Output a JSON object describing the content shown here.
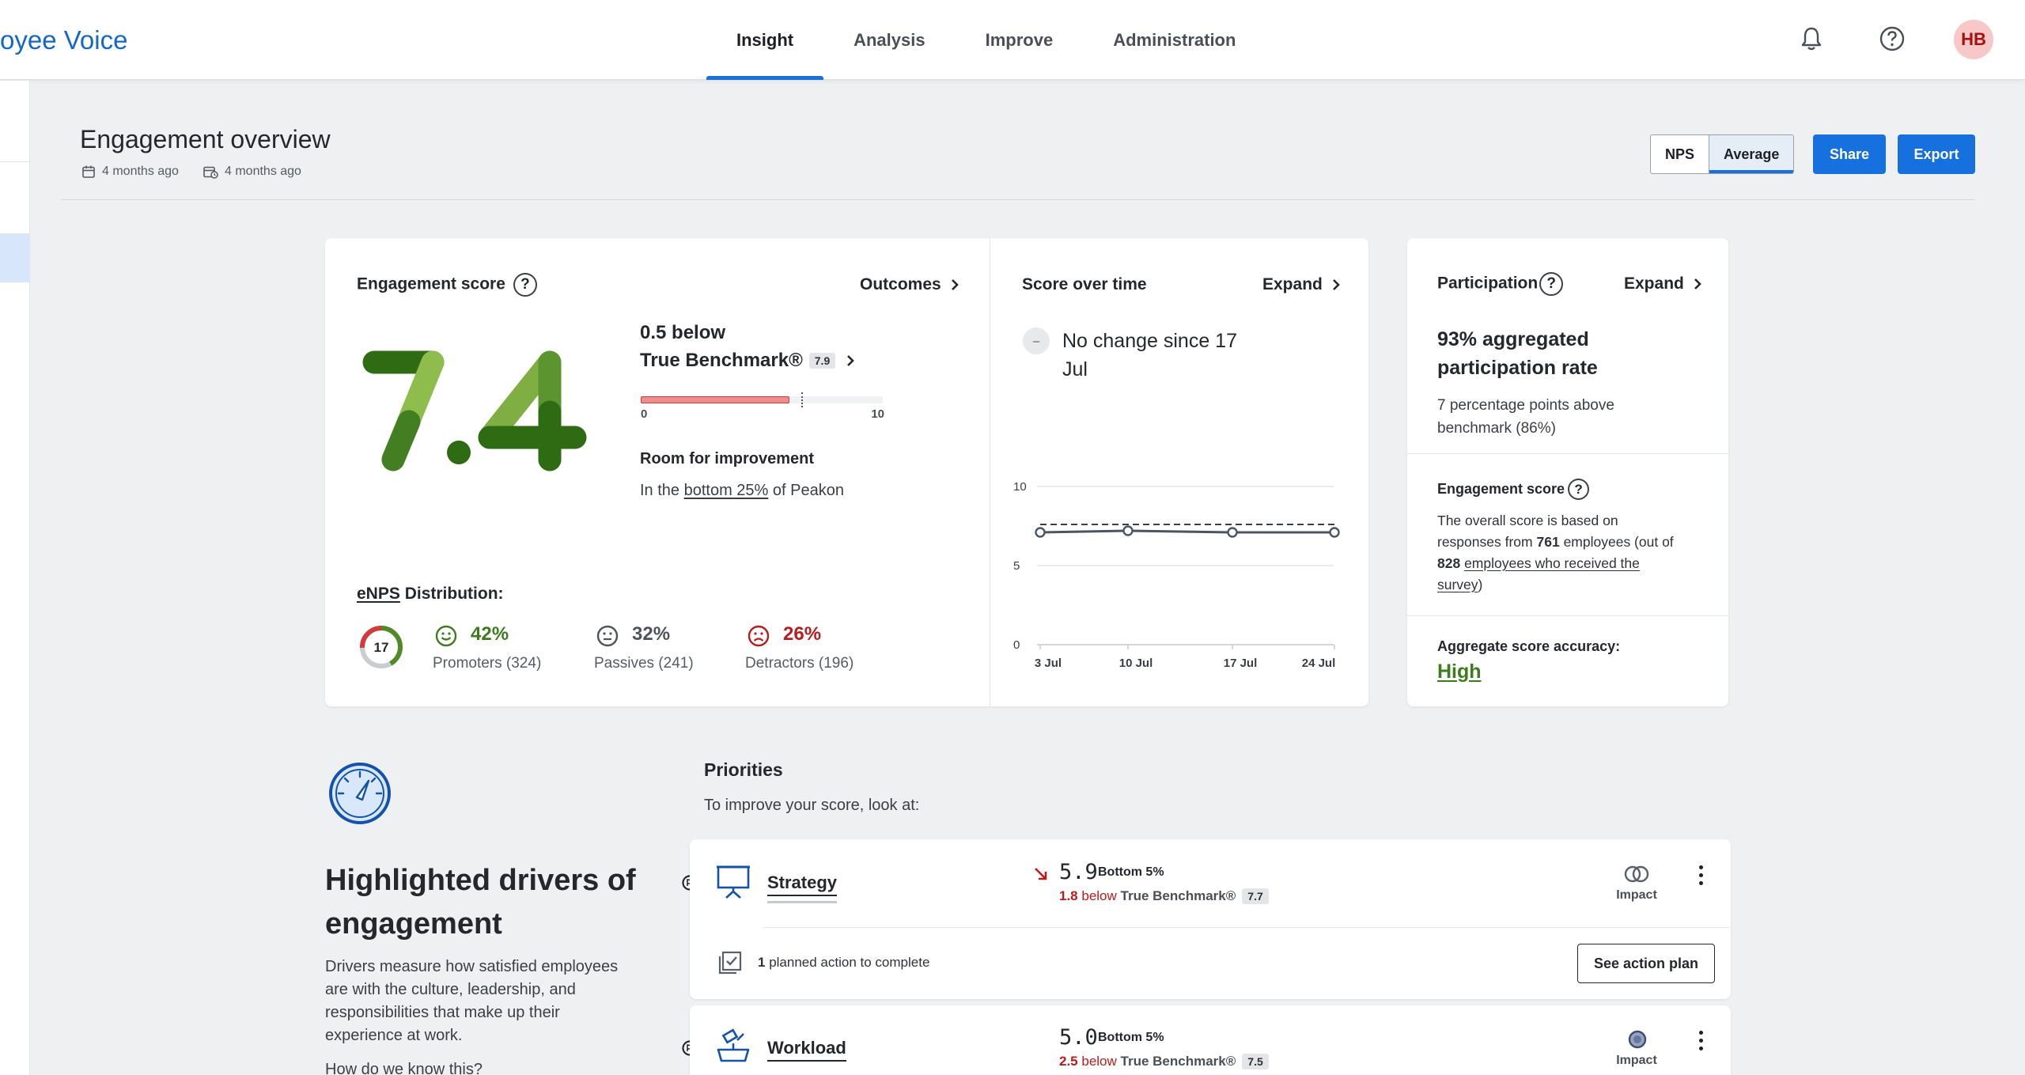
{
  "app": {
    "brand": "oyee Voice"
  },
  "nav": {
    "insight": "Insight",
    "analysis": "Analysis",
    "improve": "Improve",
    "administration": "Administration"
  },
  "user": {
    "initials": "HB"
  },
  "header": {
    "title": "Engagement overview",
    "date_start": "4 months ago",
    "date_compare": "4 months ago",
    "toggle_nps": "NPS",
    "toggle_average": "Average",
    "share": "Share",
    "export": "Export"
  },
  "engagement": {
    "title": "Engagement score",
    "help": "?",
    "outcomes": "Outcomes",
    "score": 7.4,
    "benchmark_line1": "0.5 below",
    "benchmark_line2": "True Benchmark®",
    "benchmark_value": "7.9",
    "scale_min": "0",
    "scale_max": "10",
    "score_fraction": 0.74,
    "benchmark_fraction": 0.79,
    "room_title": "Room for improvement",
    "room_pre": "In the",
    "room_link": "bottom 25%",
    "room_post": "of Peakon",
    "enps_label_link": "eNPS",
    "enps_label_rest": "Distribution:",
    "enps_value": "17",
    "promoters_pct": "42%",
    "promoters_label": "Promoters (324)",
    "passives_pct": "32%",
    "passives_label": "Passives (241)",
    "detractors_pct": "26%",
    "detractors_label": "Detractors (196)"
  },
  "score_time": {
    "title": "Score over time",
    "expand": "Expand",
    "change_icon": "–",
    "change_line1": "No change since 17",
    "change_line2": "Jul"
  },
  "chart_data": {
    "type": "line",
    "x": [
      "3 Jul",
      "10 Jul",
      "17 Jul",
      "24 Jul"
    ],
    "series": [
      {
        "values": [
          7.1,
          7.2,
          7.1,
          7.1
        ],
        "color": "#4b5563"
      }
    ],
    "benchmark": 7.6,
    "ylim": [
      0,
      10
    ],
    "yticks": [
      "0",
      "5",
      "10"
    ],
    "grid": true
  },
  "participation": {
    "title": "Participation",
    "expand": "Expand",
    "rate_line1": "93% aggregated",
    "rate_line2": "participation rate",
    "above_line1": "7 percentage points above",
    "above_line2": "benchmark (86%)",
    "engagement_title": "Engagement score",
    "desc_l1": "The overall score is based on",
    "desc_l2_pre": "responses from",
    "desc_l2_num": "761",
    "desc_l2_post": "employees (out of",
    "desc_l3_num": "828",
    "desc_l3_link": "employees who received the",
    "desc_l4_link": "survey",
    "desc_l4_post": ")",
    "accuracy_title": "Aggregate score accuracy:",
    "accuracy_value": "High"
  },
  "drivers": {
    "title_line1": "Highlighted drivers of",
    "title_line2": "engagement",
    "desc_l1": "Drivers measure how satisfied employees",
    "desc_l2": "are with the culture, leadership, and",
    "desc_l3": "responsibilities that make up their",
    "desc_l4": "experience at work.",
    "desc_l5": "How do we know this?"
  },
  "priorities": {
    "title": "Priorities",
    "subtitle": "To improve your score, look at:",
    "items": [
      {
        "name": "Strategy",
        "score": "5.9",
        "rank": "Bottom 5%",
        "diff": "1.8",
        "below": "below",
        "benchmark_label": "True Benchmark®",
        "benchmark_value": "7.7",
        "impact": "Impact",
        "actions_num": "1",
        "actions_text": "planned action to complete",
        "action_button": "See action plan"
      },
      {
        "name": "Workload",
        "score": "5.0",
        "rank": "Bottom 5%",
        "diff": "2.5",
        "below": "below",
        "benchmark_label": "True Benchmark®",
        "benchmark_value": "7.5",
        "impact": "Impact"
      }
    ]
  },
  "colors": {
    "primary": "#1670dd",
    "score_green_dark": "#2f6b12",
    "score_green_light": "#8ebd4e",
    "progress_red": "#ef8d8d",
    "negative": "#b81c1c"
  }
}
